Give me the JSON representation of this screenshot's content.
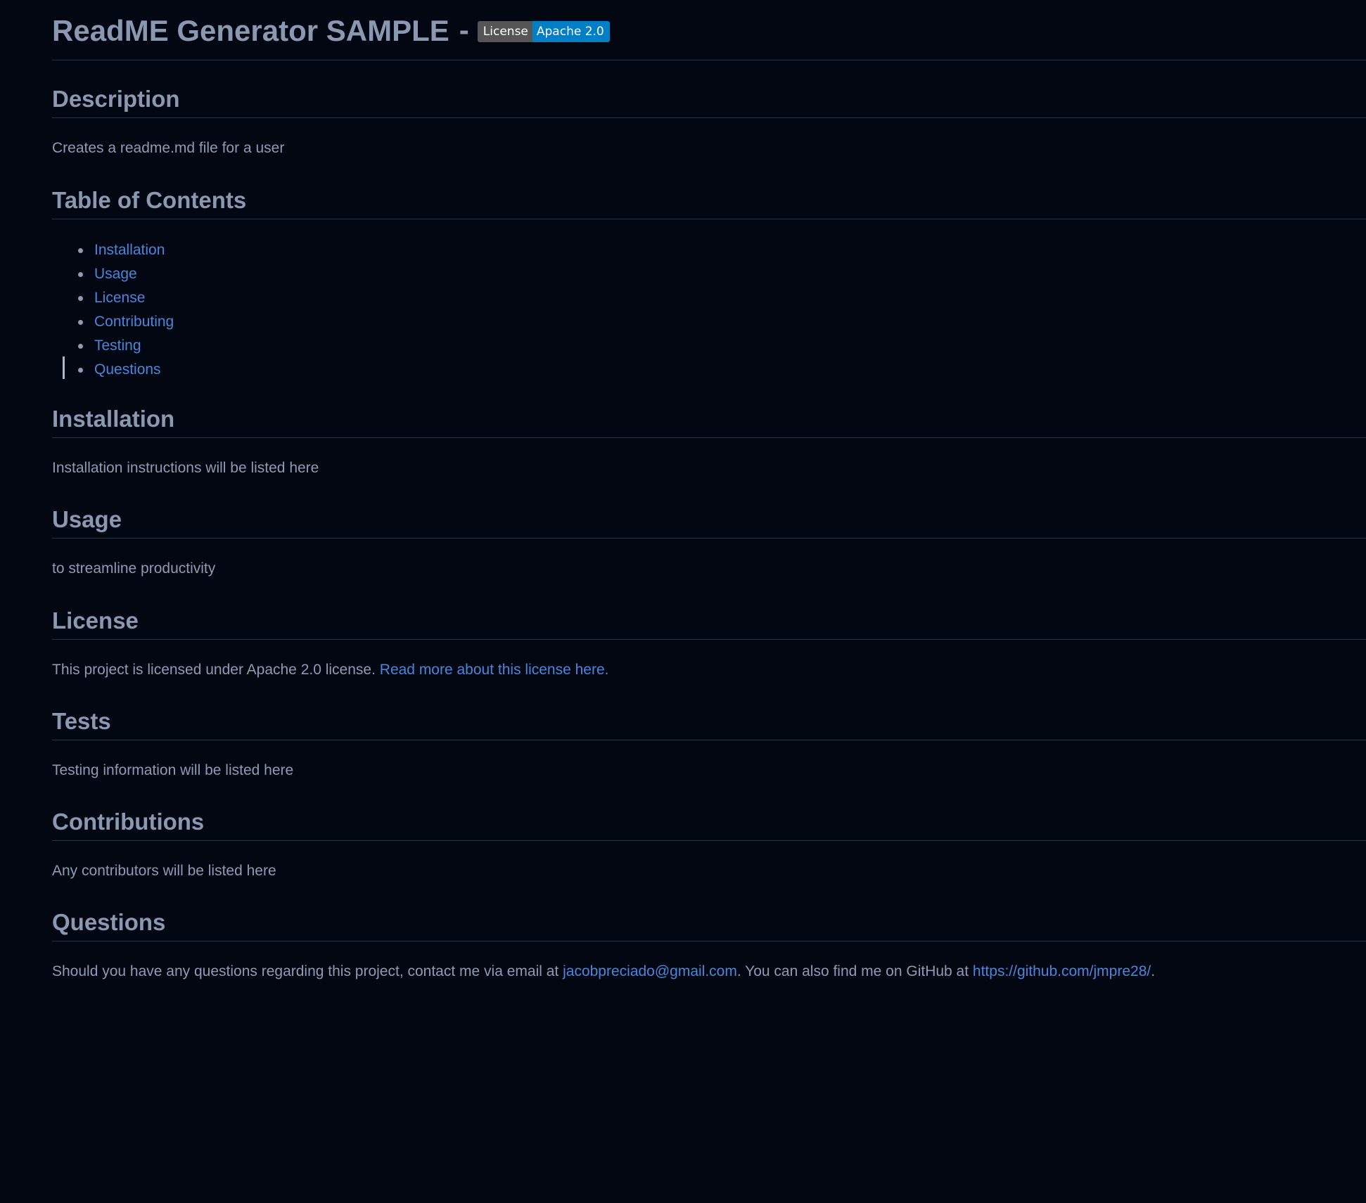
{
  "header": {
    "title": "ReadME Generator SAMPLE",
    "separator": "-",
    "badge": {
      "label": "License",
      "message": "Apache 2.0",
      "label_color": "#555555",
      "message_color": "#007ec6"
    }
  },
  "description": {
    "heading": "Description",
    "text": "Creates a readme.md file for a user"
  },
  "toc": {
    "heading": "Table of Contents",
    "items": [
      {
        "label": "Installation"
      },
      {
        "label": "Usage"
      },
      {
        "label": "License"
      },
      {
        "label": "Contributing"
      },
      {
        "label": "Testing"
      },
      {
        "label": "Questions"
      }
    ]
  },
  "installation": {
    "heading": "Installation",
    "text": "Installation instructions will be listed here"
  },
  "usage": {
    "heading": "Usage",
    "text": "to streamline productivity"
  },
  "license": {
    "heading": "License",
    "text": "This project is licensed under Apache 2.0 license.",
    "link_text": "Read more about this license here."
  },
  "tests": {
    "heading": "Tests",
    "text": "Testing information will be listed here"
  },
  "contributions": {
    "heading": "Contributions",
    "text": "Any contributors will be listed here"
  },
  "questions": {
    "heading": "Questions",
    "text_before": "Should you have any questions regarding this project, contact me via email at",
    "email": "jacobpreciado@gmail.com",
    "text_middle": ". You can also find me on GitHub at",
    "github": "https://github.com/jmpre28/",
    "text_after": "."
  },
  "colors": {
    "background": "#030712",
    "text": "#8f9bb2",
    "link": "#4a86dc",
    "rule": "#2a3344"
  }
}
